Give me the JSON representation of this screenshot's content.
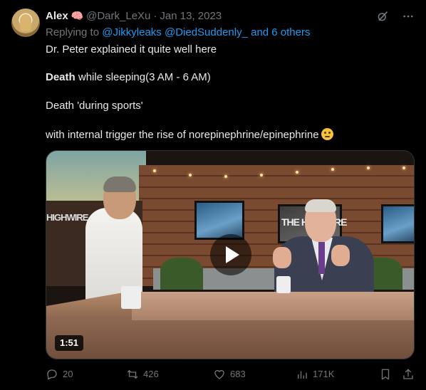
{
  "tweet": {
    "author_name": "Alex",
    "author_emoji": "🧠",
    "author_handle": "@Dark_LeXu",
    "separator": "·",
    "date": "Jan 13, 2023",
    "reply_prefix": "Replying to",
    "reply_to": "@Jikkyleaks @DiedSuddenly_ and 6 others",
    "lines": [
      "Dr. Peter explained it quite well here",
      "while sleeping(3 AM - 6 AM)",
      "Death 'during sports'",
      "with internal trigger the rise of norepinephrine/epinephrine"
    ],
    "bold_word": "Death",
    "video": {
      "duration": "1:51",
      "logo_left": "HIGHWIRE",
      "logo_screen": "THE HIGHWIRE"
    }
  },
  "actions": {
    "replies": "20",
    "reposts": "426",
    "likes": "683",
    "views": "171K"
  },
  "colors": {
    "accent": "#1d9bf0",
    "muted": "#71767b",
    "text": "#e7e9ea",
    "background": "#000000"
  },
  "icons": [
    "grok-icon",
    "more-icon",
    "reply-icon",
    "repost-icon",
    "like-icon",
    "views-icon",
    "bookmark-icon",
    "share-icon"
  ]
}
